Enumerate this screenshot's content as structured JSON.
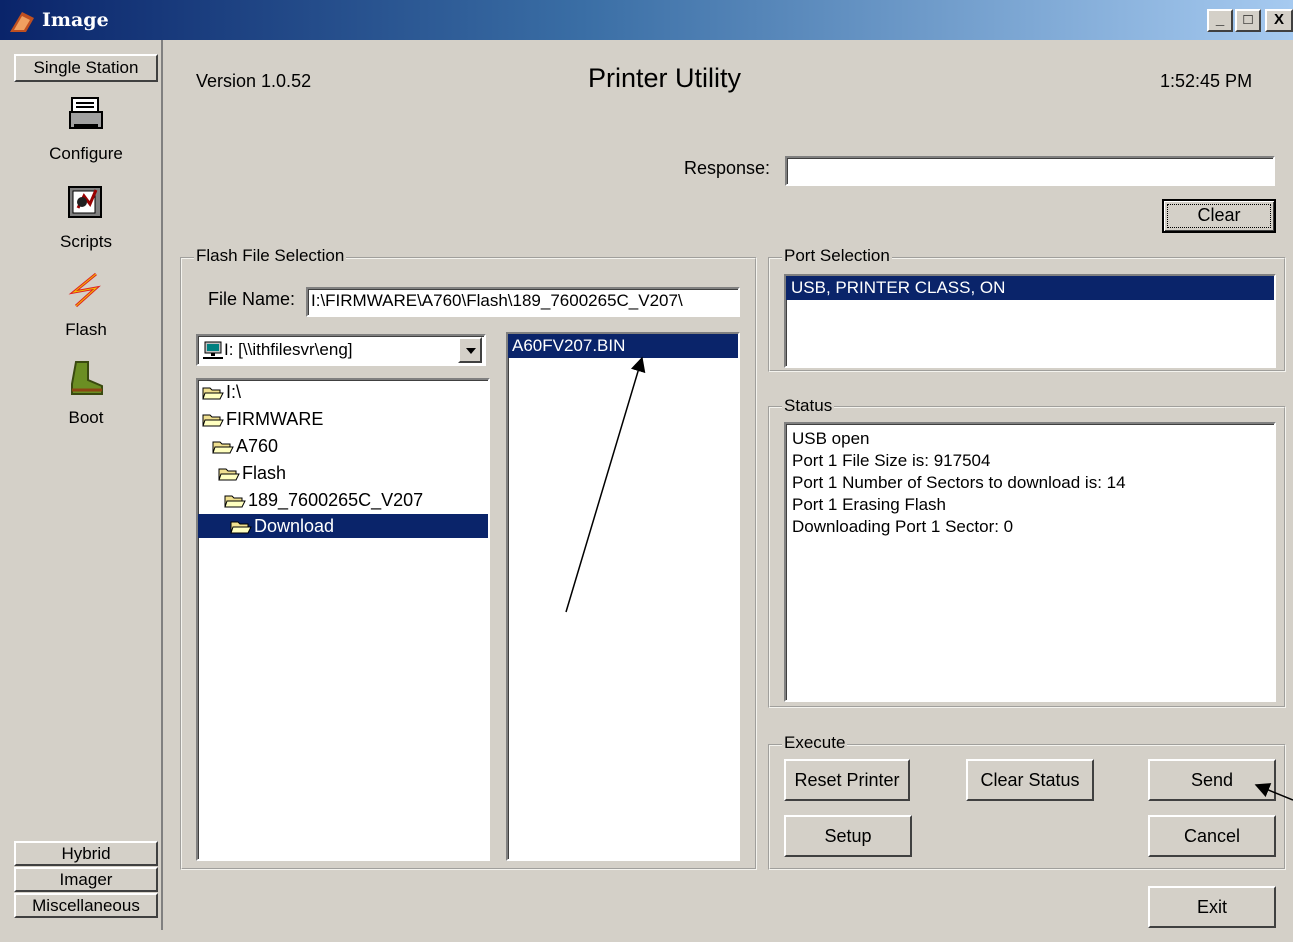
{
  "window": {
    "title": "Image",
    "min": "_",
    "max": "□",
    "close": "X"
  },
  "sidebar": {
    "top_tab": "Single Station",
    "items": [
      {
        "label": "Configure",
        "icon": "printer-icon"
      },
      {
        "label": "Scripts",
        "icon": "scripts-icon"
      },
      {
        "label": "Flash",
        "icon": "lightning-icon"
      },
      {
        "label": "Boot",
        "icon": "boot-icon"
      }
    ],
    "bottom_tabs": [
      "Hybrid",
      "Imager",
      "Miscellaneous"
    ]
  },
  "header": {
    "version": "Version  1.0.52",
    "title": "Printer Utility",
    "time": "1:52:45 PM"
  },
  "response": {
    "label": "Response:",
    "value": "",
    "clear_label": "Clear"
  },
  "flash": {
    "group_label": "Flash File Selection",
    "file_name_label": "File Name:",
    "file_name_value": "I:\\FIRMWARE\\A760\\Flash\\189_7600265C_V207\\",
    "drive": "I: [\\\\ithfilesvr\\eng]",
    "tree": [
      "I:\\",
      "FIRMWARE",
      "A760",
      "Flash",
      "189_7600265C_V207",
      "Download"
    ],
    "files": [
      "A60FV207.BIN"
    ]
  },
  "port": {
    "group_label": "Port Selection",
    "items": [
      "USB, PRINTER CLASS, ON"
    ]
  },
  "status": {
    "group_label": "Status",
    "lines": [
      "USB open",
      "Port 1 File Size is: 917504",
      "Port 1 Number of Sectors to download is: 14",
      "Port 1 Erasing Flash",
      "Downloading Port 1 Sector: 0"
    ]
  },
  "execute": {
    "group_label": "Execute",
    "reset": "Reset Printer",
    "clear_status": "Clear Status",
    "send": "Send",
    "setup": "Setup",
    "cancel": "Cancel"
  },
  "exit_label": "Exit",
  "colors": {
    "selection": "#0a246a",
    "face": "#d4d0c8",
    "titlebar": "#0a246a"
  }
}
